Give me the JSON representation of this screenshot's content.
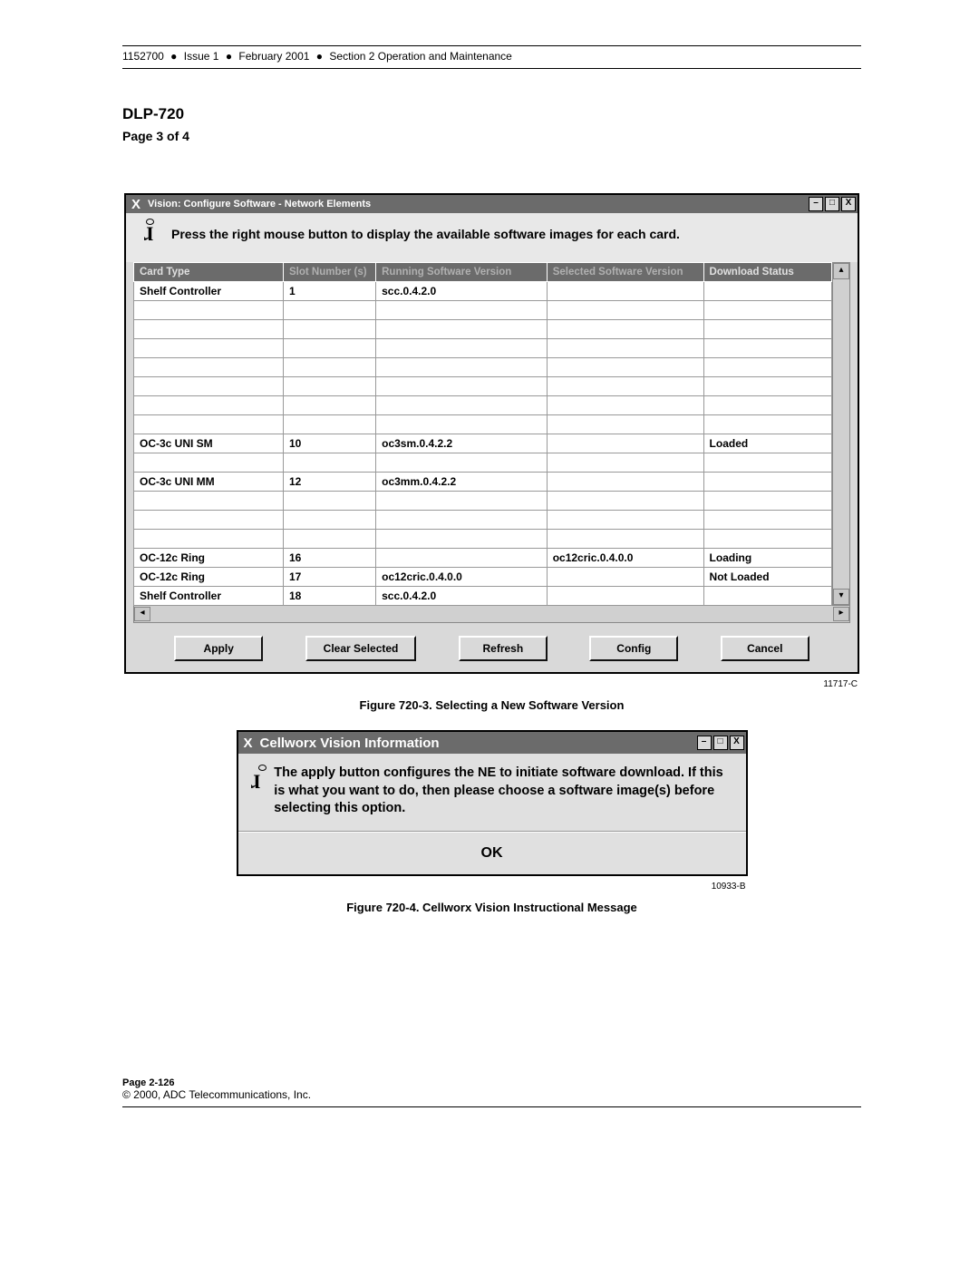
{
  "doc_header": {
    "doc_num": "1152700",
    "issue": "Issue 1",
    "date": "February 2001",
    "section": "Section 2 Operation and Maintenance"
  },
  "dlp_title": "DLP-720",
  "page_of": "Page 3 of 4",
  "window1": {
    "title": "Vision: Configure Software -  Network Elements",
    "hint": "Press the right mouse button to display the available software images for each card.",
    "columns": [
      "Card Type",
      "Slot Number (s)",
      "Running Software Version",
      "Selected Software Version",
      "Download Status"
    ],
    "rows": [
      {
        "card": "Shelf Controller",
        "slot": "1",
        "running": "scc.0.4.2.0",
        "selected": "",
        "status": ""
      },
      {
        "card": "",
        "slot": "",
        "running": "",
        "selected": "",
        "status": ""
      },
      {
        "card": "",
        "slot": "",
        "running": "",
        "selected": "",
        "status": ""
      },
      {
        "card": "",
        "slot": "",
        "running": "",
        "selected": "",
        "status": ""
      },
      {
        "card": "",
        "slot": "",
        "running": "",
        "selected": "",
        "status": ""
      },
      {
        "card": "",
        "slot": "",
        "running": "",
        "selected": "",
        "status": ""
      },
      {
        "card": "",
        "slot": "",
        "running": "",
        "selected": "",
        "status": ""
      },
      {
        "card": "",
        "slot": "",
        "running": "",
        "selected": "",
        "status": ""
      },
      {
        "card": "OC-3c UNI SM",
        "slot": "10",
        "running": "oc3sm.0.4.2.2",
        "selected": "",
        "status": "Loaded"
      },
      {
        "card": "",
        "slot": "",
        "running": "",
        "selected": "",
        "status": ""
      },
      {
        "card": "OC-3c UNI MM",
        "slot": "12",
        "running": "oc3mm.0.4.2.2",
        "selected": "",
        "status": ""
      },
      {
        "card": "",
        "slot": "",
        "running": "",
        "selected": "",
        "status": ""
      },
      {
        "card": "",
        "slot": "",
        "running": "",
        "selected": "",
        "status": ""
      },
      {
        "card": "",
        "slot": "",
        "running": "",
        "selected": "",
        "status": ""
      },
      {
        "card": "OC-12c Ring",
        "slot": "16",
        "running": "",
        "selected": "oc12cric.0.4.0.0",
        "status": "Loading"
      },
      {
        "card": "OC-12c Ring",
        "slot": "17",
        "running": "oc12cric.0.4.0.0",
        "selected": "",
        "status": "Not Loaded"
      },
      {
        "card": "Shelf Controller",
        "slot": "18",
        "running": "scc.0.4.2.0",
        "selected": "",
        "status": ""
      }
    ],
    "buttons": {
      "apply": "Apply",
      "clear": "Clear Selected",
      "refresh": "Refresh",
      "config": "Config",
      "cancel": "Cancel"
    },
    "fig_code": "11717-C",
    "caption": "Figure 720-3.  Selecting a New Software Version"
  },
  "dialog": {
    "title": "Cellworx Vision Information",
    "message": "The apply button configures the NE to initiate software download. If this is what you want to do, then please choose a software image(s) before selecting this option.",
    "ok": "OK",
    "fig_code": "10933-B",
    "caption": "Figure 720-4.  Cellworx Vision Instructional Message"
  },
  "footer": {
    "page": "Page 2-126",
    "copyright": "© 2000, ADC Telecommunications, Inc."
  }
}
